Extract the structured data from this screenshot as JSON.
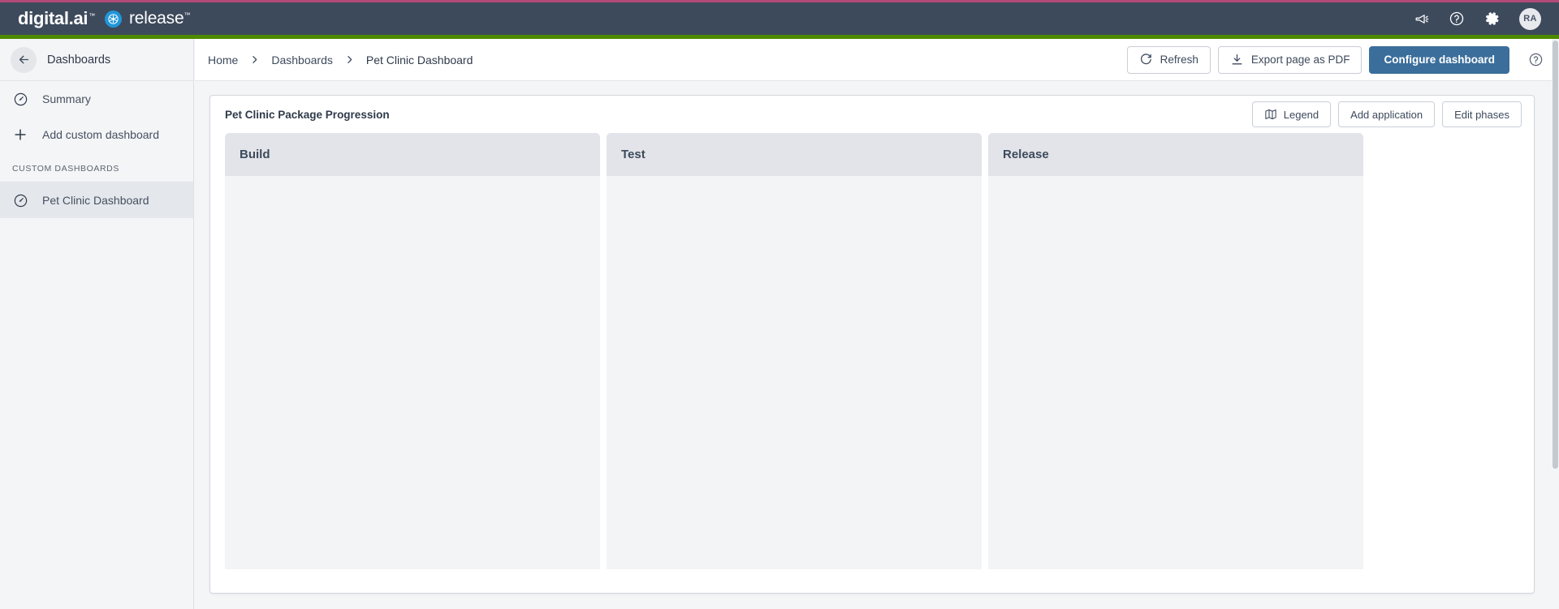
{
  "topbar": {
    "brand_primary": "digital.ai",
    "brand_secondary": "release",
    "trademark": "™",
    "icons": [
      {
        "name": "announcements-icon",
        "label": "Announcements"
      },
      {
        "name": "help-icon",
        "label": "Help"
      },
      {
        "name": "settings-gear-icon",
        "label": "Settings"
      }
    ],
    "avatar_initials": "RA",
    "accent_color": "#b14a78",
    "bar_color": "#3d4a5c",
    "env_bar_color": "#4e8a00"
  },
  "sidebar": {
    "header_label": "Dashboards",
    "back_icon": "arrow-left-icon",
    "items": [
      {
        "label": "Summary",
        "icon": "gauge-icon",
        "active": false
      },
      {
        "label": "Add custom dashboard",
        "icon": "plus-icon",
        "active": false
      }
    ],
    "section_label": "CUSTOM DASHBOARDS",
    "custom_dashboards": [
      {
        "label": "Pet Clinic Dashboard",
        "icon": "gauge-icon",
        "active": true
      }
    ]
  },
  "header": {
    "breadcrumb": [
      {
        "label": "Home",
        "current": false
      },
      {
        "label": "Dashboards",
        "current": false
      },
      {
        "label": "Pet Clinic Dashboard",
        "current": true
      }
    ],
    "separator": "›",
    "buttons": {
      "refresh": "Refresh",
      "export_pdf": "Export page as PDF",
      "configure": "Configure dashboard"
    },
    "help_icon": "help-circle-icon",
    "primary_color": "#3b6e9b"
  },
  "panel": {
    "title": "Pet Clinic Package Progression",
    "buttons": {
      "legend": "Legend",
      "add_application": "Add application",
      "edit_phases": "Edit phases"
    },
    "legend_icon": "map-icon",
    "phases": [
      {
        "name": "Build",
        "applications": []
      },
      {
        "name": "Test",
        "applications": []
      },
      {
        "name": "Release",
        "applications": []
      }
    ]
  }
}
